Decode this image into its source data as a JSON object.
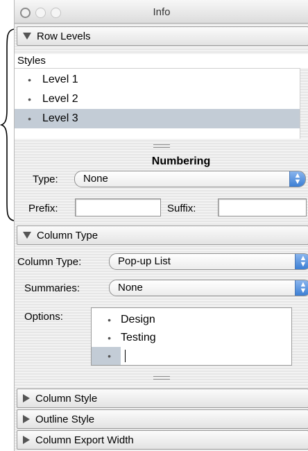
{
  "window": {
    "title": "Info"
  },
  "sections": {
    "row_levels": {
      "label": "Row Levels",
      "expanded": true
    },
    "column_type": {
      "label": "Column Type",
      "expanded": true
    },
    "column_style": {
      "label": "Column Style",
      "expanded": false
    },
    "outline_style": {
      "label": "Outline Style",
      "expanded": false
    },
    "column_export_width": {
      "label": "Column Export Width",
      "expanded": false
    }
  },
  "styles": {
    "label": "Styles",
    "items": [
      {
        "label": "Level 1",
        "selected": false
      },
      {
        "label": "Level 2",
        "selected": false
      },
      {
        "label": "Level 3",
        "selected": true
      }
    ]
  },
  "numbering": {
    "title": "Numbering",
    "type_label": "Type:",
    "type_value": "None",
    "prefix_label": "Prefix:",
    "prefix_value": "",
    "suffix_label": "Suffix:",
    "suffix_value": ""
  },
  "column_type": {
    "type_label": "Column Type:",
    "type_value": "Pop-up List",
    "summaries_label": "Summaries:",
    "summaries_value": "None",
    "options_label": "Options:",
    "options": [
      {
        "label": "Design"
      },
      {
        "label": "Testing"
      },
      {
        "label": ""
      }
    ]
  },
  "icons": {
    "bullet": "•",
    "stepper": "▲▼"
  },
  "colors": {
    "selection": "#c3ccd6",
    "stepper_blue": "#3c7fd4"
  }
}
